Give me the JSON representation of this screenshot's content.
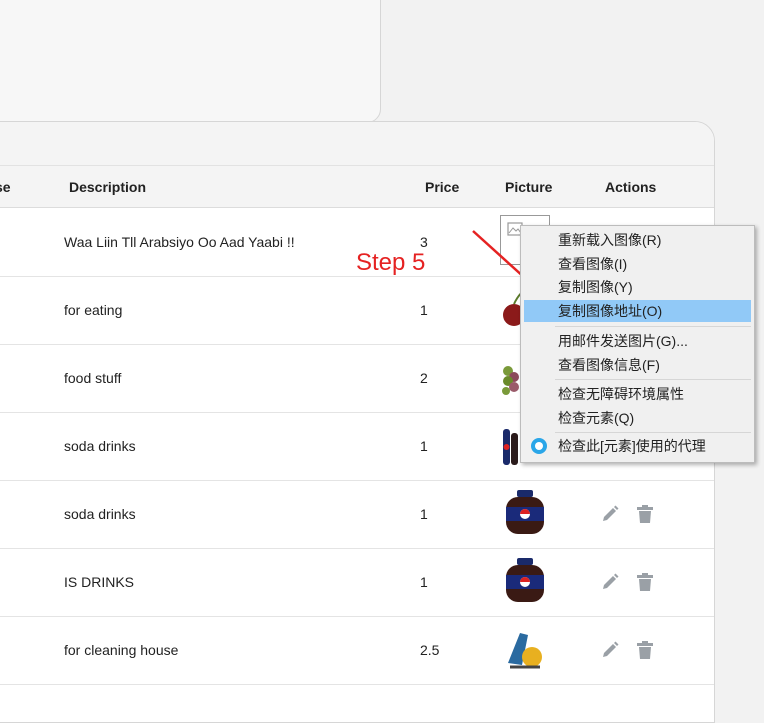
{
  "table": {
    "headers": {
      "partial": "se",
      "description": "Description",
      "price": "Price",
      "picture": "Picture",
      "actions": "Actions"
    },
    "rows": [
      {
        "description": "Waa Liin Tll Arabsiyo Oo Aad Yaabi !!",
        "price": "3",
        "picture": "broken-image"
      },
      {
        "description": "for eating",
        "price": "1",
        "picture": "cherry"
      },
      {
        "description": "food stuff",
        "price": "2",
        "picture": "grapes"
      },
      {
        "description": "soda drinks",
        "price": "1",
        "picture": "pepsi-bottles"
      },
      {
        "description": "soda drinks",
        "price": "1",
        "picture": "pepsi-jar"
      },
      {
        "description": "IS DRINKS",
        "price": "1",
        "picture": "pepsi-jar"
      },
      {
        "description": "for cleaning house",
        "price": "2.5",
        "picture": "cleaning-tool"
      }
    ]
  },
  "context_menu": {
    "items": [
      {
        "label": "重新载入图像(R)"
      },
      {
        "label": "查看图像(I)"
      },
      {
        "label": "复制图像(Y)"
      },
      {
        "label": "复制图像地址(O)",
        "highlighted": true
      },
      {
        "label": "用邮件发送图片(G)..."
      },
      {
        "label": "查看图像信息(F)"
      },
      {
        "label": "检查无障碍环境属性"
      },
      {
        "label": "检查元素(Q)"
      },
      {
        "label": "检查此[元素]使用的代理"
      }
    ]
  },
  "annotation": {
    "label": "Step 5",
    "color": "#e52222"
  },
  "colors": {
    "highlight": "#91c9f7",
    "action_icon": "#9aa0a6",
    "header_bg": "#f4f4f4"
  }
}
